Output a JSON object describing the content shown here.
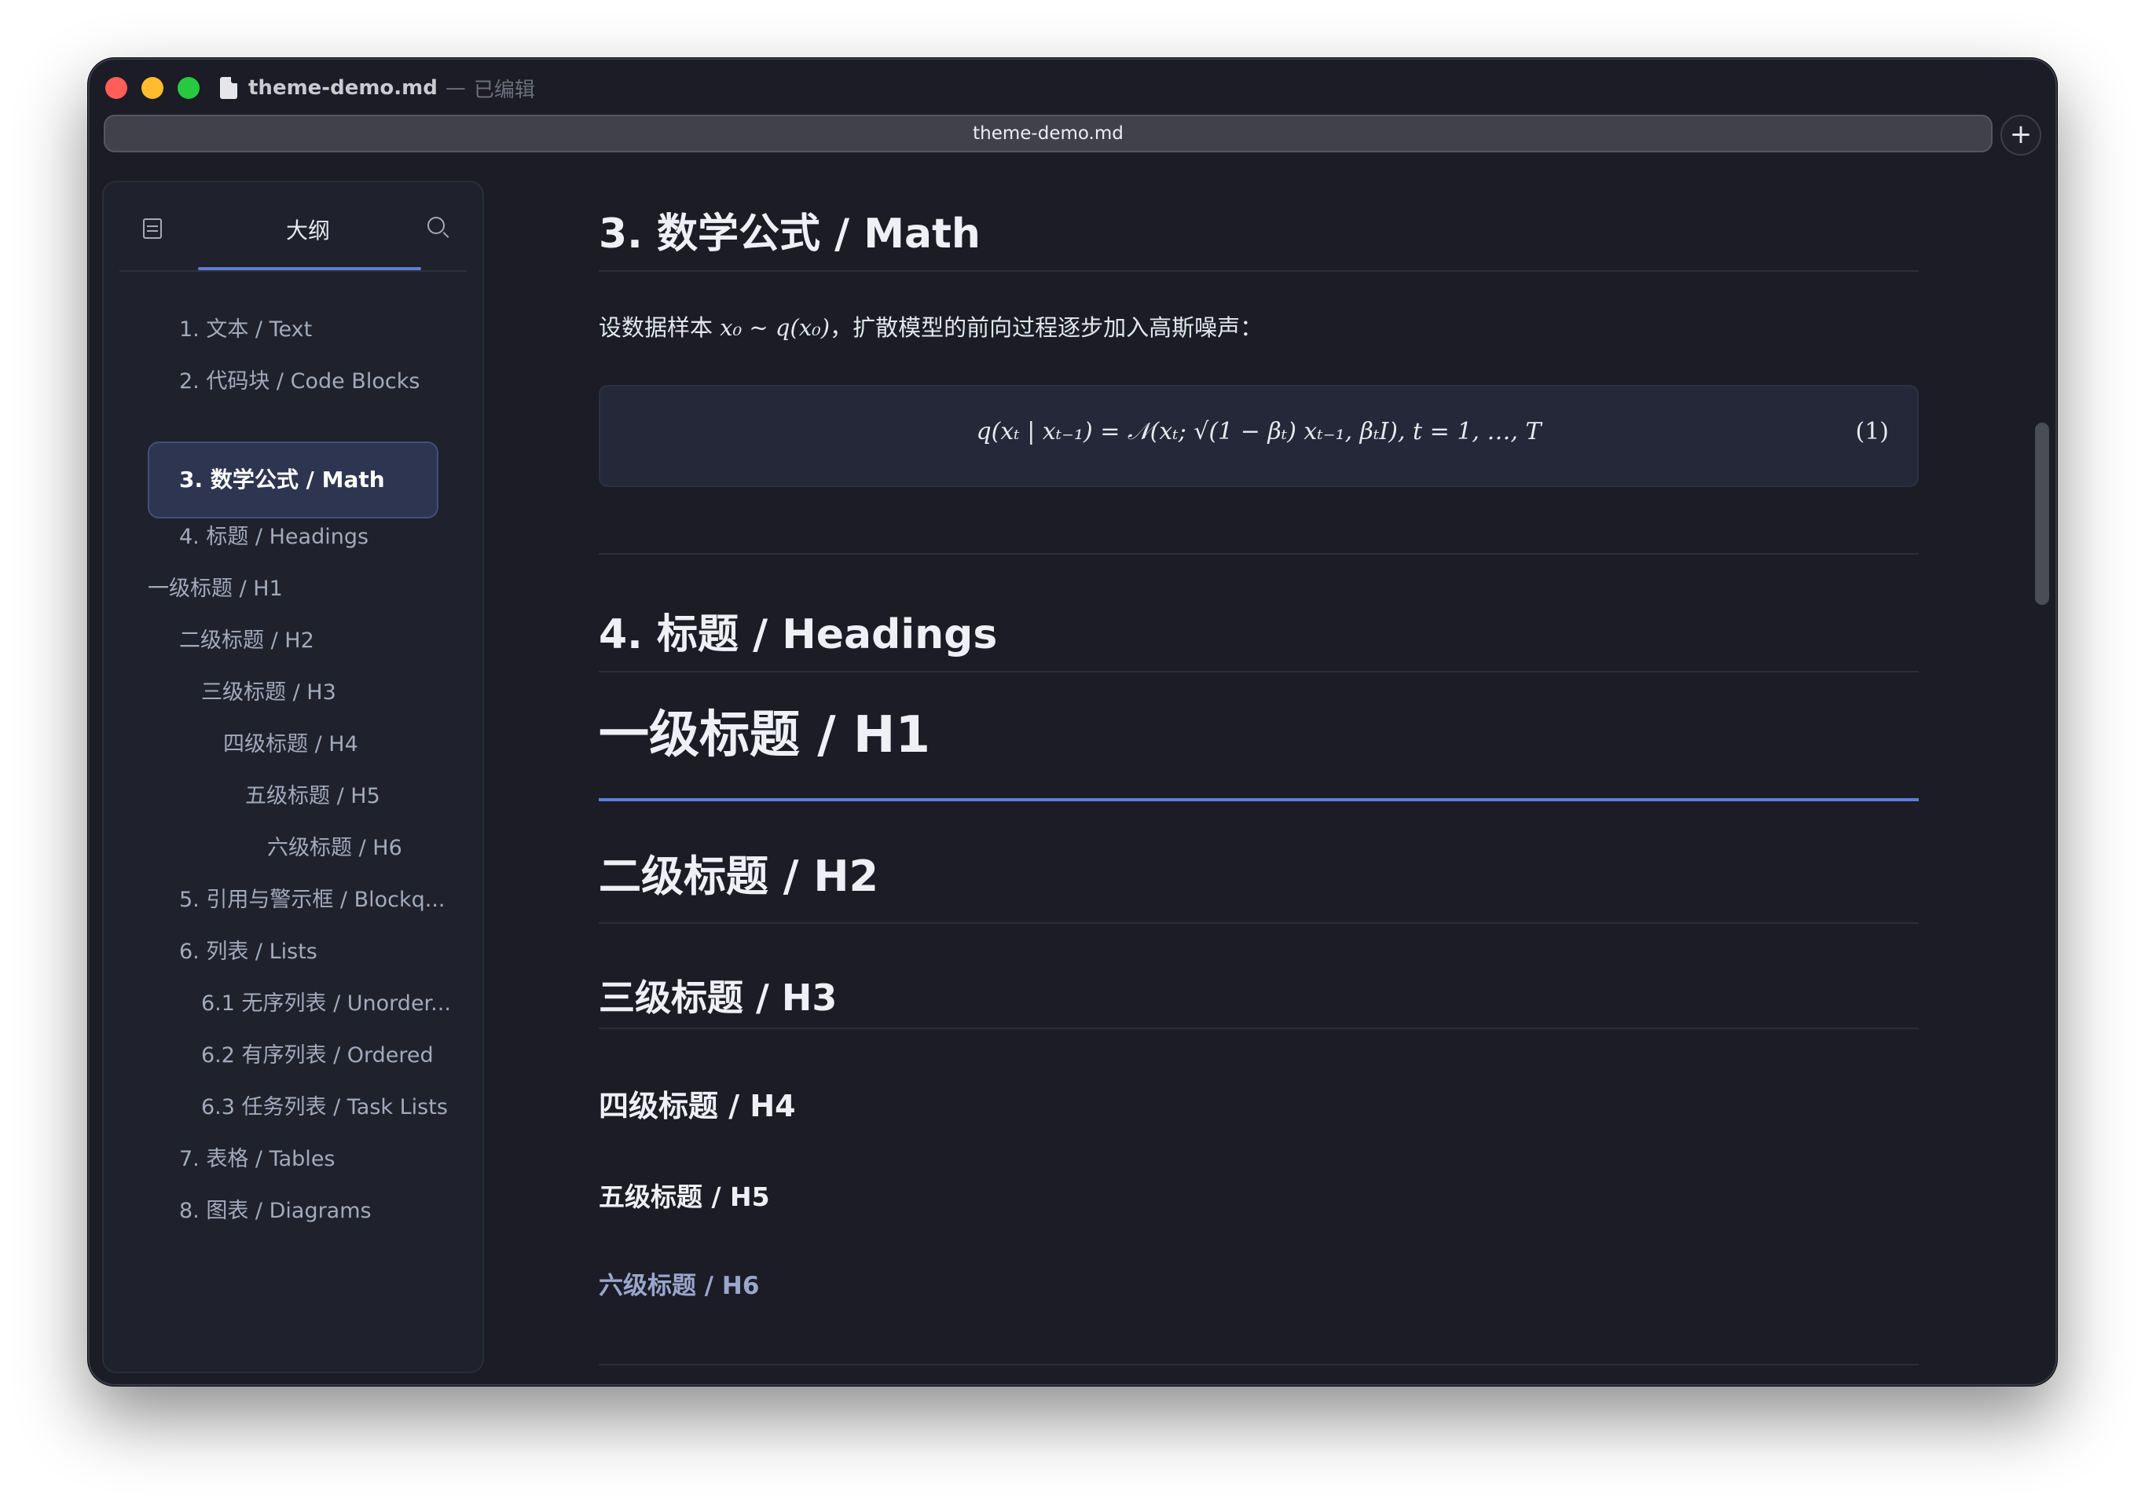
{
  "window": {
    "file_name": "theme-demo.md",
    "separator": "—",
    "status": "已编辑",
    "tab_label": "theme-demo.md",
    "add_tab": "+"
  },
  "sidebar": {
    "tab_label": "大纲",
    "items": [
      {
        "label": "1. 文本 / Text"
      },
      {
        "label": "2. 代码块 / Code Blocks"
      },
      {
        "label": "3. 数学公式 / Math",
        "active": true
      },
      {
        "label": "4. 标题 / Headings"
      },
      {
        "label": "一级标题 / H1"
      },
      {
        "label": "二级标题 / H2"
      },
      {
        "label": "三级标题 / H3"
      },
      {
        "label": "四级标题 / H4"
      },
      {
        "label": "五级标题 / H5"
      },
      {
        "label": "六级标题 / H6"
      },
      {
        "label": "5. 引用与警示框 / Blockq..."
      },
      {
        "label": "6. 列表 / Lists"
      },
      {
        "label": "6.1 无序列表 / Unorder..."
      },
      {
        "label": "6.2 有序列表 / Ordered"
      },
      {
        "label": "6.3 任务列表 / Task Lists"
      },
      {
        "label": "7. 表格 / Tables"
      },
      {
        "label": "8. 图表 / Diagrams"
      }
    ]
  },
  "content": {
    "math_heading": "3. 数学公式 / Math",
    "para_prefix": "设数据样本 ",
    "para_math": "x₀ ∼ q(x₀)",
    "para_suffix": "，扩散模型的前向过程逐步加入高斯噪声：",
    "equation": "q(xₜ | xₜ₋₁) = 𝒩(xₜ; √(1 − βₜ) xₜ₋₁, βₜI),    t = 1, …, T",
    "equation_number": "(1)",
    "headings_heading": "4. 标题 / Headings",
    "h1": "一级标题 / H1",
    "h2": "二级标题 / H2",
    "h3": "三级标题 / H3",
    "h4": "四级标题 / H4",
    "h5": "五级标题 / H5",
    "h6": "六级标题 / H6"
  },
  "colors": {
    "background": "#1b1c26",
    "accent": "#5c7fd6",
    "h6": "#9aa6cc"
  }
}
